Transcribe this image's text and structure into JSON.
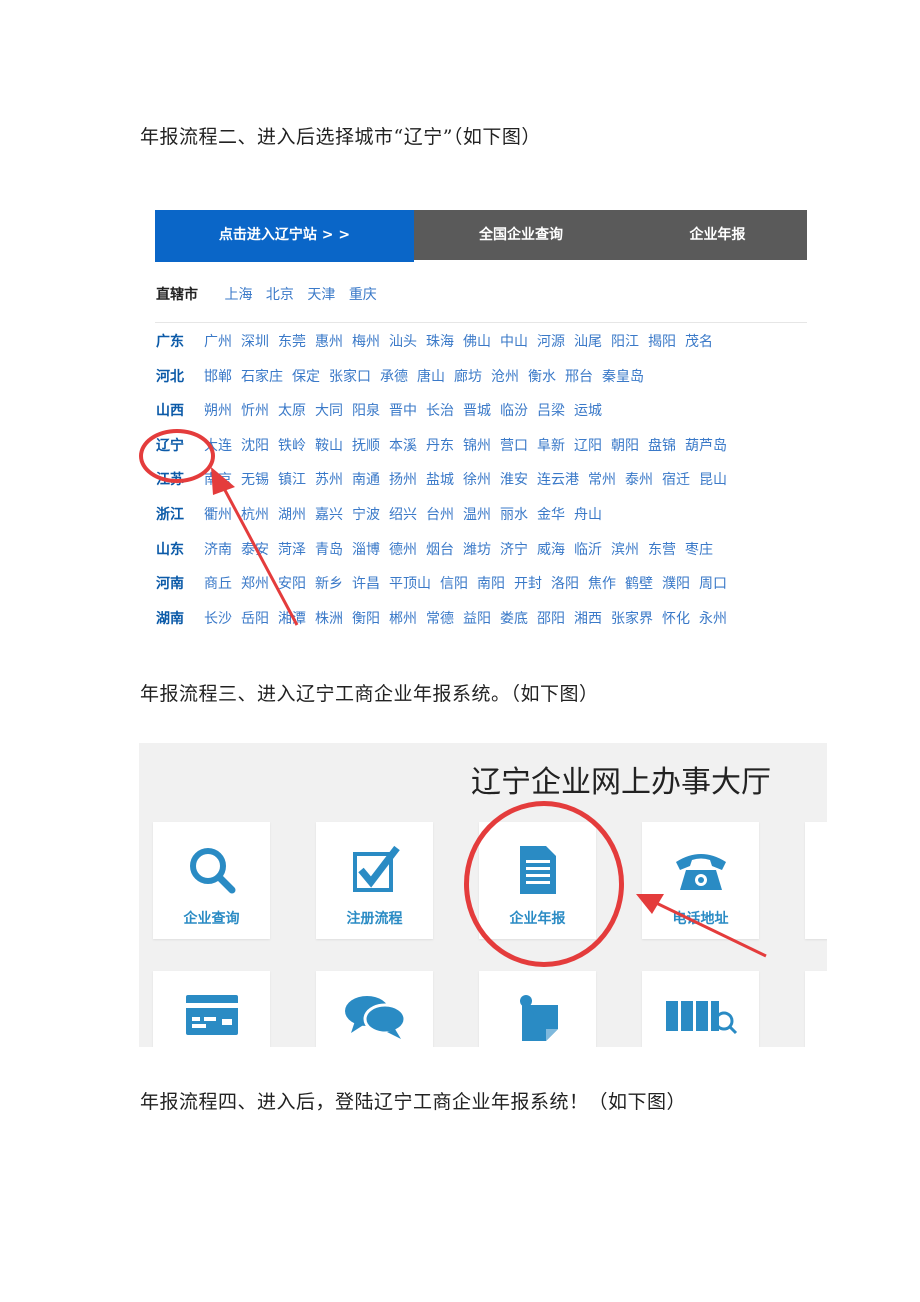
{
  "steps": {
    "step2": "年报流程二、进入后选择城市“辽宁”（如下图）",
    "step3": "年报流程三、进入辽宁工商企业年报系统。（如下图）",
    "step4": "年报流程四、进入后，登陆辽宁工商企业年报系统！（如下图）"
  },
  "nav": {
    "enter_liaoning": "点击进入辽宁站 > >",
    "national_query": "全国企业查询",
    "annual_report": "企业年报"
  },
  "regions": {
    "municipalities": {
      "label": "直辖市",
      "cities": [
        "上海",
        "北京",
        "天津",
        "重庆"
      ]
    },
    "provinces": [
      {
        "name": "广东",
        "cities": [
          "广州",
          "深圳",
          "东莞",
          "惠州",
          "梅州",
          "汕头",
          "珠海",
          "佛山",
          "中山",
          "河源",
          "汕尾",
          "阳江",
          "揭阳",
          "茂名"
        ]
      },
      {
        "name": "河北",
        "cities": [
          "邯郸",
          "石家庄",
          "保定",
          "张家口",
          "承德",
          "唐山",
          "廊坊",
          "沧州",
          "衡水",
          "邢台",
          "秦皇岛"
        ]
      },
      {
        "name": "山西",
        "cities": [
          "朔州",
          "忻州",
          "太原",
          "大同",
          "阳泉",
          "晋中",
          "长治",
          "晋城",
          "临汾",
          "吕梁",
          "运城"
        ]
      },
      {
        "name": "辽宁",
        "cities": [
          "大连",
          "沈阳",
          "铁岭",
          "鞍山",
          "抚顺",
          "本溪",
          "丹东",
          "锦州",
          "营口",
          "阜新",
          "辽阳",
          "朝阳",
          "盘锦",
          "葫芦岛"
        ]
      },
      {
        "name": "江苏",
        "cities": [
          "南京",
          "无锡",
          "镇江",
          "苏州",
          "南通",
          "扬州",
          "盐城",
          "徐州",
          "淮安",
          "连云港",
          "常州",
          "泰州",
          "宿迁",
          "昆山"
        ]
      },
      {
        "name": "浙江",
        "cities": [
          "衢州",
          "杭州",
          "湖州",
          "嘉兴",
          "宁波",
          "绍兴",
          "台州",
          "温州",
          "丽水",
          "金华",
          "舟山"
        ]
      },
      {
        "name": "山东",
        "cities": [
          "济南",
          "泰安",
          "菏泽",
          "青岛",
          "淄博",
          "德州",
          "烟台",
          "潍坊",
          "济宁",
          "威海",
          "临沂",
          "滨州",
          "东营",
          "枣庄"
        ]
      },
      {
        "name": "河南",
        "cities": [
          "商丘",
          "郑州",
          "安阳",
          "新乡",
          "许昌",
          "平顶山",
          "信阳",
          "南阳",
          "开封",
          "洛阳",
          "焦作",
          "鹤壁",
          "濮阳",
          "周口"
        ]
      },
      {
        "name": "湖南",
        "cities": [
          "长沙",
          "岳阳",
          "湘潭",
          "株洲",
          "衡阳",
          "郴州",
          "常德",
          "益阳",
          "娄底",
          "邵阳",
          "湘西",
          "张家界",
          "怀化",
          "永州"
        ]
      }
    ]
  },
  "hall": {
    "title": "辽宁企业网上办事大厅",
    "tiles": [
      {
        "label": "企业查询",
        "icon": "search-icon"
      },
      {
        "label": "注册流程",
        "icon": "checkbox-icon"
      },
      {
        "label": "企业年报",
        "icon": "document-icon"
      },
      {
        "label": "电话地址",
        "icon": "telephone-icon"
      }
    ],
    "tiles_row2": [
      {
        "icon": "card-icon"
      },
      {
        "icon": "chat-bubbles-icon"
      },
      {
        "icon": "sticky-note-icon"
      },
      {
        "icon": "archive-search-icon"
      }
    ]
  },
  "colors": {
    "accent": "#0a66c8",
    "navbar": "#5a5a5a",
    "city_link": "#3a79c8",
    "tile_icon": "#2a8bc4",
    "highlight": "#e43c3c"
  }
}
